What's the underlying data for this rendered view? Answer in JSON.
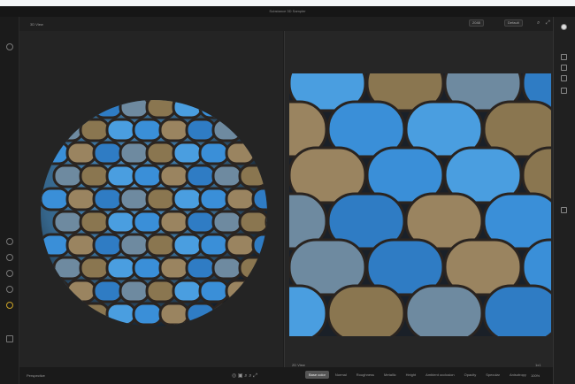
{
  "window": {
    "title": "Substance 3D Sampler"
  },
  "view3d": {
    "label": "3D View",
    "camera": "Perspective"
  },
  "view2d": {
    "label": "2D View",
    "zoom": "100%",
    "tiling": "1x1"
  },
  "toolbar": {
    "resolution": "2048",
    "display": "Default"
  },
  "channels": {
    "tabs": [
      "Base color",
      "Normal",
      "Roughness",
      "Metallic",
      "Height",
      "Ambient occlusion",
      "Opacity",
      "Specular",
      "Anisotropy"
    ],
    "active": 0
  },
  "colors": {
    "blue": "#3a8fd8",
    "bronze": "#8a7650",
    "bg": "#242424"
  }
}
